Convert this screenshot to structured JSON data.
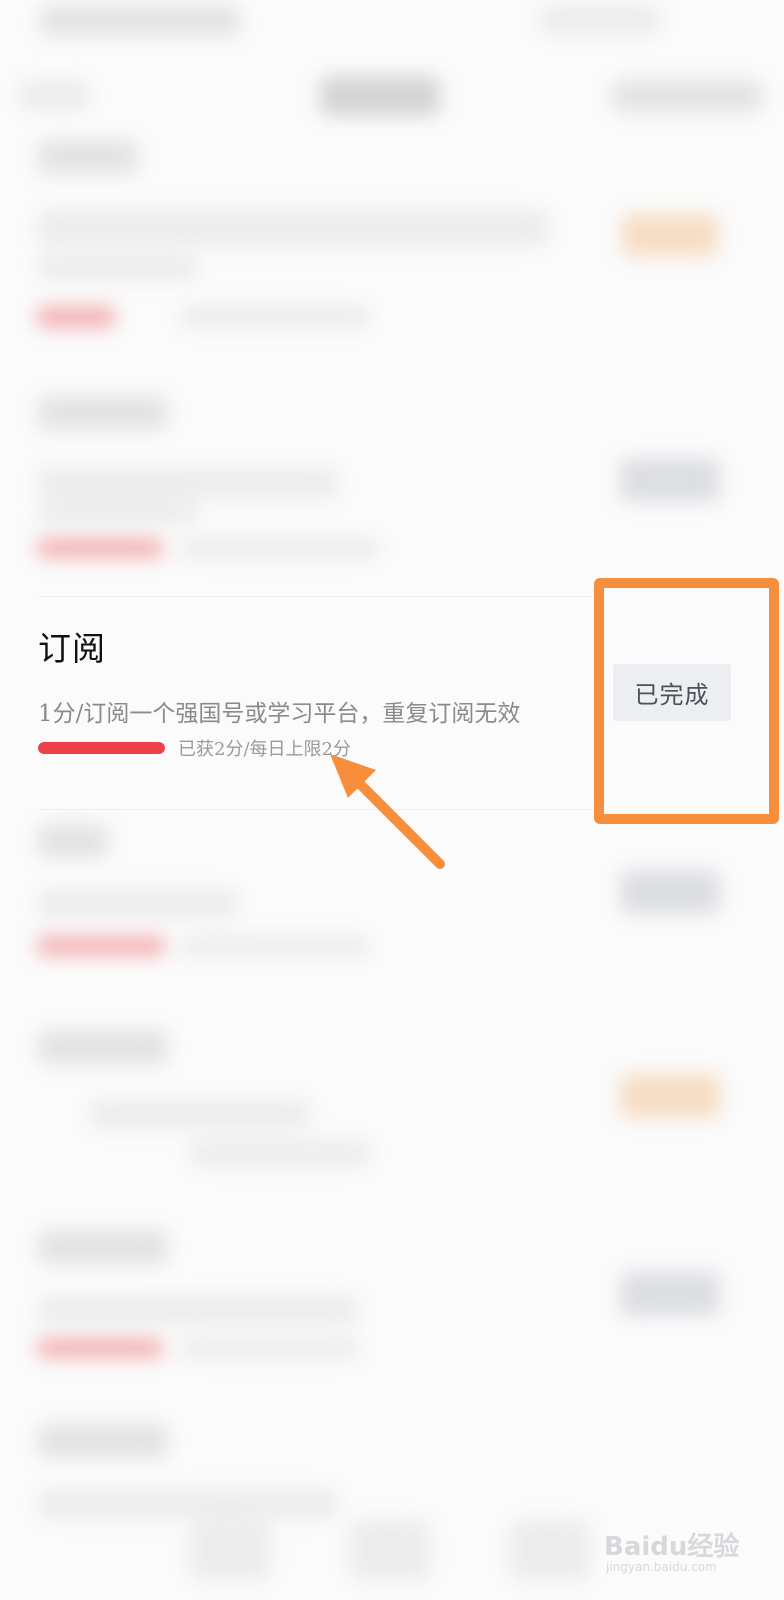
{
  "task": {
    "title": "订阅",
    "description": "1分/订阅一个强国号或学习平台，重复订阅无效",
    "progress_text": "已获2分/每日上限2分",
    "progress_fraction": 1.0,
    "button_label": "已完成"
  },
  "colors": {
    "highlight": "#f78e3c",
    "progress": "#ee3f4a",
    "button_bg": "#eceef2"
  },
  "watermark": {
    "logo": "Baidu经验",
    "sub": "jingyan.baidu.com"
  }
}
